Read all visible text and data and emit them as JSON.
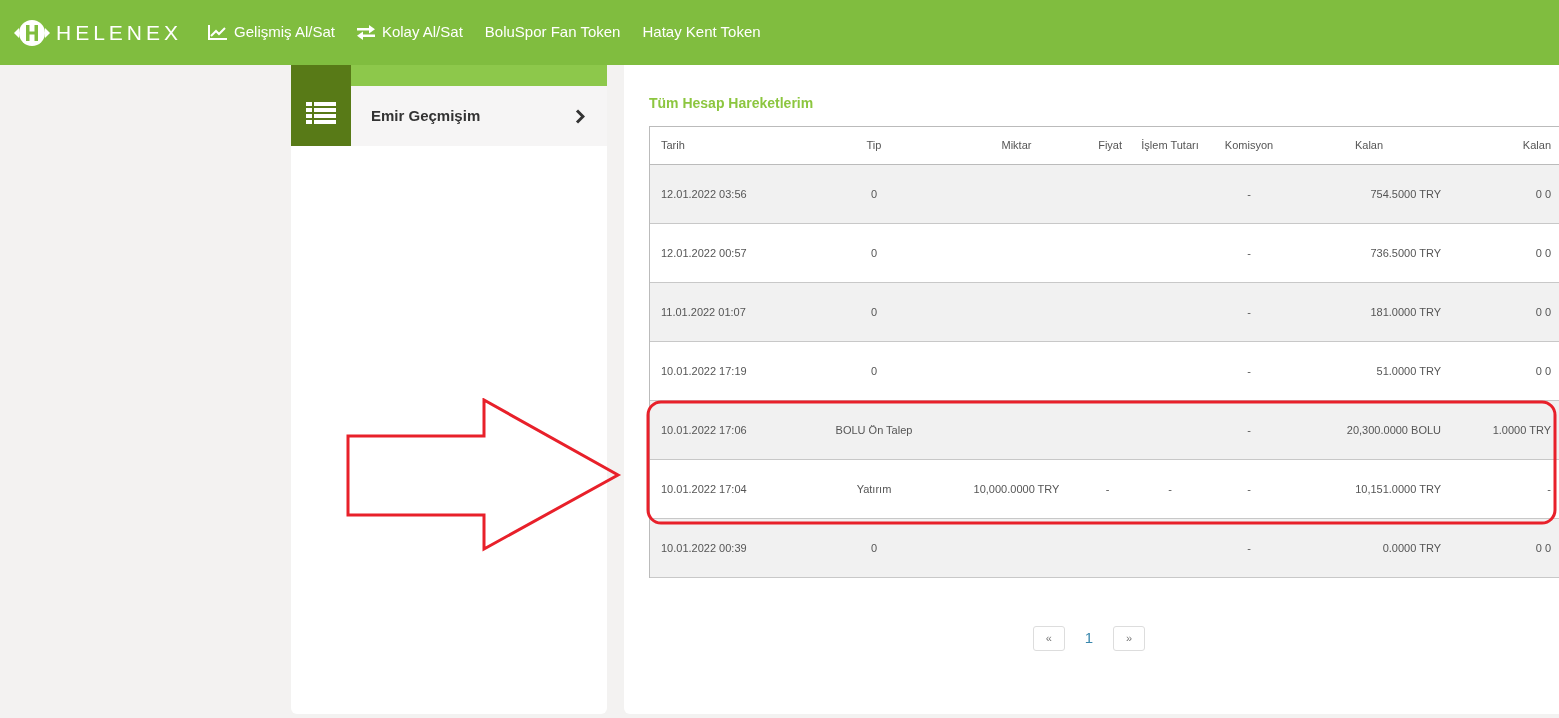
{
  "nav": {
    "logo": "HELENEX",
    "items": [
      {
        "label": "Gelişmiş Al/Sat",
        "kind": "chart"
      },
      {
        "label": "Kolay Al/Sat",
        "kind": "swap"
      },
      {
        "label": "BoluSpor Fan Token",
        "kind": "plain"
      },
      {
        "label": "Hatay Kent Token",
        "kind": "plain"
      }
    ]
  },
  "sidebar": {
    "items": [
      {
        "label": "Emir Geçmişim"
      }
    ]
  },
  "table": {
    "title": "Tüm Hesap Hareketlerim",
    "columns": [
      "Tarih",
      "Tip",
      "Miktar",
      "Fiyat",
      "İşlem Tutarı",
      "Komisyon",
      "Kalan",
      "Kalan"
    ],
    "rows": [
      [
        "12.01.2022 03:56",
        "0",
        "",
        "",
        "",
        "-",
        "754.5000 TRY",
        "0 0"
      ],
      [
        "12.01.2022 00:57",
        "0",
        "",
        "",
        "",
        "-",
        "736.5000 TRY",
        "0 0"
      ],
      [
        "11.01.2022 01:07",
        "0",
        "",
        "",
        "",
        "-",
        "181.0000 TRY",
        "0 0"
      ],
      [
        "10.01.2022 17:19",
        "0",
        "",
        "",
        "",
        "-",
        "51.0000 TRY",
        "0 0"
      ],
      [
        "10.01.2022 17:06",
        "BOLU Ön Talep",
        "",
        "",
        "",
        "-",
        "20,300.0000 BOLU",
        "1.0000 TRY"
      ],
      [
        "10.01.2022 17:04",
        "Yatırım",
        "10,000.0000 TRY",
        "-",
        "-",
        "-",
        "10,151.0000 TRY",
        "-"
      ],
      [
        "10.01.2022 00:39",
        "0",
        "",
        "",
        "",
        "-",
        "0.0000 TRY",
        "0 0"
      ]
    ]
  },
  "pagination": {
    "prev": "«",
    "pages": [
      {
        "label": "1",
        "selected": true
      }
    ],
    "next": "»"
  }
}
